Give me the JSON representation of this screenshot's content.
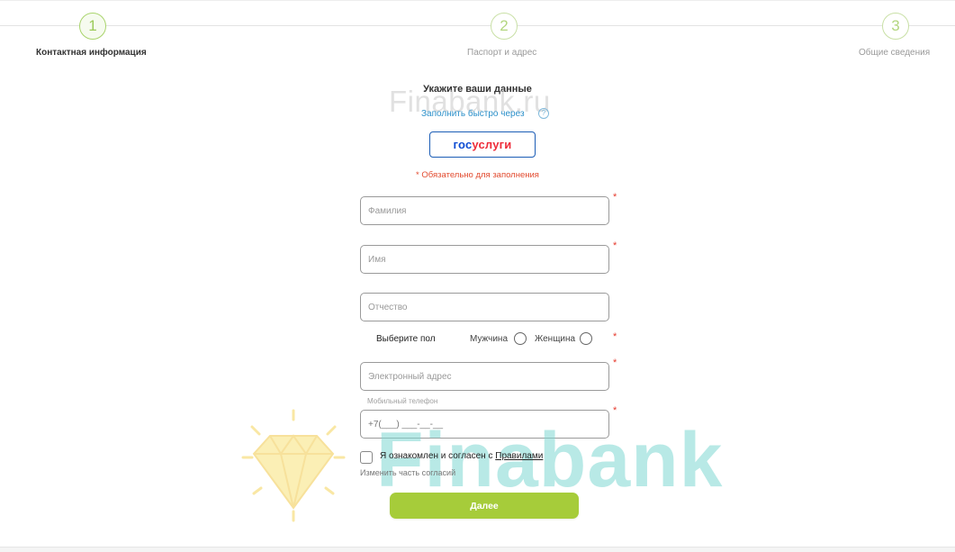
{
  "stepper": {
    "steps": [
      {
        "number": "1",
        "label": "Контактная информация",
        "active": true
      },
      {
        "number": "2",
        "label": "Паспорт и адрес",
        "active": false
      },
      {
        "number": "3",
        "label": "Общие сведения",
        "active": false
      }
    ]
  },
  "watermarks": {
    "top": "Finabank.ru",
    "big": "Finabank"
  },
  "form": {
    "heading": "Укажите ваши данные",
    "quick_fill": "Заполнить быстро через",
    "help_icon": "?",
    "gosuslugi": {
      "part1": "гос",
      "part2": "услуги"
    },
    "required_note": "* Обязательно для заполнения",
    "required_star": "*",
    "fields": {
      "surname_placeholder": "Фамилия",
      "name_placeholder": "Имя",
      "patronymic_placeholder": "Отчество",
      "email_placeholder": "Электронный адрес",
      "phone_label": "Мобильный телефон",
      "phone_placeholder": "+7(___) ___-__-__"
    },
    "gender": {
      "label": "Выберите пол",
      "male": "Мужчина",
      "female": "Женщина"
    },
    "consent": {
      "text": "Я ознакомлен и согласен с",
      "link": "Правилами",
      "change": "Изменить часть согласий"
    },
    "submit": "Далее"
  },
  "colors": {
    "accent_green": "#a6cc3a",
    "step_green": "#9ccb59",
    "link_blue": "#2a8fc9",
    "required_red": "#e24a2e",
    "gos_blue": "#0d4cd3",
    "gos_red": "#ee2c3a"
  },
  "icons": {
    "help": "question-circle-icon",
    "watermark_logo": "diamond-logo-icon"
  }
}
